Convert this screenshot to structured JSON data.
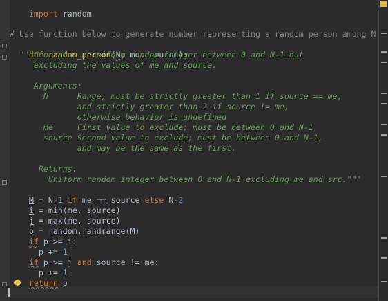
{
  "code": {
    "import_kw": "import",
    "import_mod": " random",
    "comment": "# Use function below to generate number representing a random person among N",
    "def_kw": "def",
    "func_name": "random_person",
    "params_open": "(",
    "param_n": "N",
    "params_rest": ", me, source):",
    "doc": [
      "  \"\"\"Generates a uniform random integer between 0 and N-1 but",
      "     excluding the values of me and source.",
      "",
      "     Arguments:",
      "       N      Range; must be strictly greater than 1 if source == me,",
      "              and strictly greater than 2 if source != me,",
      "              otherwise behavior is undefined",
      "       me     First value to exclude; must be between 0 and N-1",
      "       source Second value to exclude; must be between 0 and N-1,",
      "              and may be the same as the first.",
      "",
      "      Returns:",
      "        Uniform random integer between 0 and N-1 excluding me and src.\"\"\""
    ],
    "body": {
      "l1_var": "M",
      "l1_a": " = N-",
      "l1_num": "1",
      "l1_if": "if",
      "l1_b": " me == source ",
      "l1_else": "else",
      "l1_c": " N-",
      "l1_num2": "2",
      "l2_var": "i",
      "l2_rest": " = min(me, source)",
      "l3_var": "j",
      "l3_rest": " = max(me, source)",
      "l4_var": "p",
      "l4_rest": " = random.randrange(M)",
      "l5_if": "if",
      "l5_rest": " p >= i:",
      "l6_rest": "  p += ",
      "l6_num": "1",
      "l7_if": "if",
      "l7_a": " p >= j ",
      "l7_and": "and",
      "l7_b": " source != me:",
      "l8_rest": "  p += ",
      "l8_num": "1",
      "l9_kw": "return",
      "l9_rest": " p"
    }
  },
  "colors": {
    "background": "#2b2b2b",
    "keyword": "#cc7832",
    "function": "#ffc66d",
    "number": "#6897bb",
    "comment": "#808080",
    "docstring": "#629755"
  },
  "icons": [
    "fold-icon",
    "intention-bulb-icon",
    "status-indicator-icon"
  ]
}
